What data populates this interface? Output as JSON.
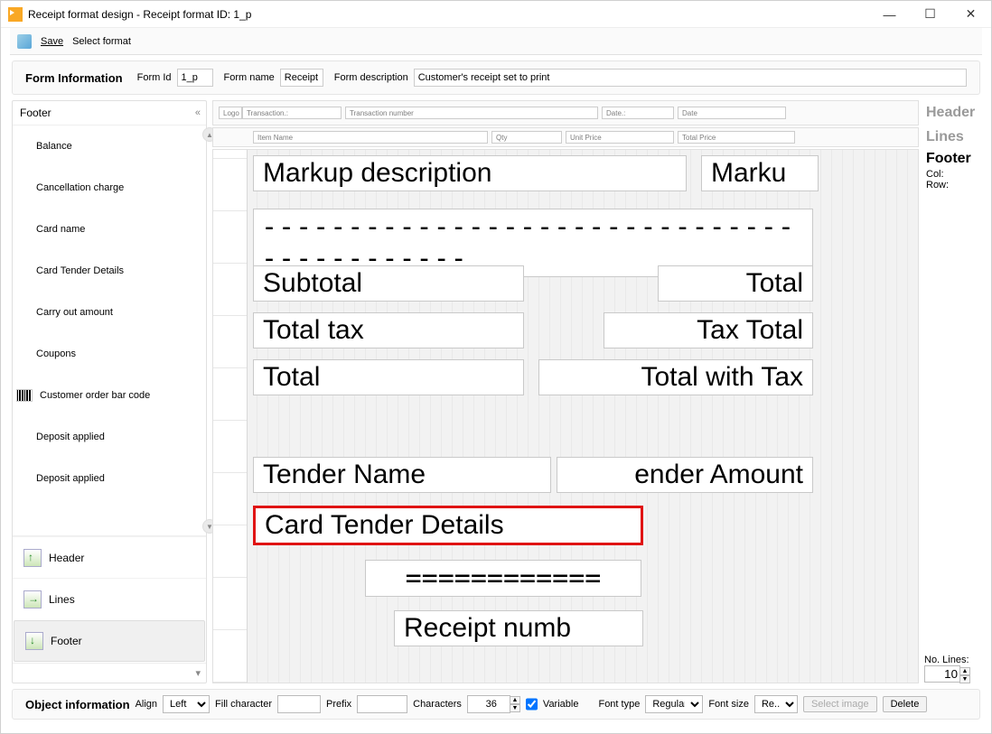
{
  "window": {
    "title": "Receipt format design - Receipt format ID: 1_p"
  },
  "toolbar": {
    "save": "Save",
    "select_format": "Select format"
  },
  "form_info": {
    "section_label": "Form Information",
    "form_id_label": "Form Id",
    "form_id_value": "1_p",
    "form_name_label": "Form name",
    "form_name_value": "Receipt",
    "form_desc_label": "Form description",
    "form_desc_value": "Customer's receipt set to print"
  },
  "sidebar": {
    "title": "Footer",
    "items": [
      "Balance",
      "Cancellation charge",
      "Card name",
      "Card Tender Details",
      "Carry out amount",
      "Coupons",
      "Customer order bar code",
      "Deposit applied",
      "Deposit applied"
    ],
    "nav": {
      "header": "Header",
      "lines": "Lines",
      "footer": "Footer"
    }
  },
  "strips": {
    "header_label": "Header",
    "lines_label": "Lines",
    "footer_label": "Footer",
    "header_boxes": {
      "logo": "Logo",
      "transaction_lbl": "Transaction.:",
      "transaction_num": "Transaction number",
      "date_lbl": "Date.:",
      "date": "Date"
    },
    "lines_boxes": {
      "item_name": "Item Name",
      "qty": "Qty",
      "unit_price": "Unit Price",
      "total_price": "Total Price"
    },
    "col_label": "Col:",
    "row_label": "Row:"
  },
  "design_fields": {
    "markup_desc": "Markup description",
    "markup_trunc": "Marku",
    "dashes": "-------------------------------------------",
    "subtotal": "Subtotal",
    "total_right": "Total",
    "total_tax": "Total tax",
    "tax_total": "Tax Total",
    "total": "Total",
    "total_with_tax": "Total with Tax",
    "tender_name": "Tender Name",
    "tender_amount": "ender Amount",
    "card_tender_details": "Card Tender Details",
    "equals": "============",
    "receipt_num": "Receipt numb"
  },
  "no_lines": {
    "label": "No. Lines:",
    "value": "10"
  },
  "objbar": {
    "section_label": "Object information",
    "align_label": "Align",
    "align_value": "Left",
    "fill_label": "Fill character",
    "fill_value": "",
    "prefix_label": "Prefix",
    "prefix_value": "",
    "chars_label": "Characters",
    "chars_value": "36",
    "variable_label": "Variable",
    "fonttype_label": "Font type",
    "fonttype_value": "Regular",
    "fontsize_label": "Font size",
    "fontsize_value": "Re...",
    "select_image": "Select image",
    "delete": "Delete"
  }
}
